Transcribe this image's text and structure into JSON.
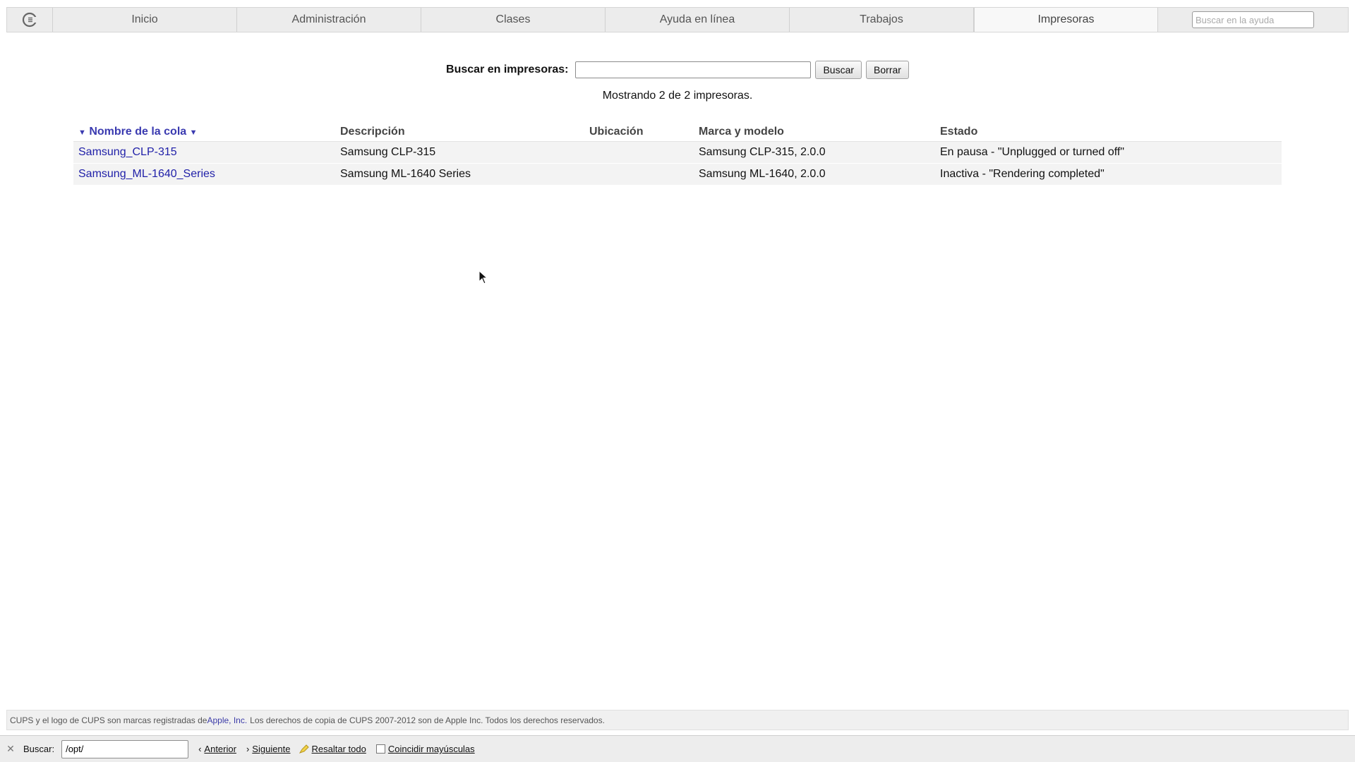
{
  "nav": {
    "logo_icon": "cups-logo-icon",
    "tabs": [
      {
        "label": "Inicio"
      },
      {
        "label": "Administración"
      },
      {
        "label": "Clases"
      },
      {
        "label": "Ayuda en línea"
      },
      {
        "label": "Trabajos"
      },
      {
        "label": "Impresoras"
      }
    ],
    "active_tab": "Impresoras",
    "help_search_placeholder": "Buscar en la ayuda"
  },
  "search": {
    "label": "Buscar en impresoras:",
    "value": "",
    "search_button": "Buscar",
    "clear_button": "Borrar"
  },
  "summary": "Mostrando 2 de 2 impresoras.",
  "table": {
    "sort_arrow_icon": "sort-down-arrow-icon",
    "headers": {
      "queue": "Nombre de la cola",
      "description": "Descripción",
      "location": "Ubicación",
      "model": "Marca y modelo",
      "state": "Estado"
    },
    "rows": [
      {
        "queue": "Samsung_CLP-315",
        "description": "Samsung CLP-315",
        "location": "",
        "model": "Samsung CLP-315, 2.0.0",
        "state": "En pausa - \"Unplugged or turned off\""
      },
      {
        "queue": "Samsung_ML-1640_Series",
        "description": "Samsung ML-1640 Series",
        "location": "",
        "model": "Samsung ML-1640, 2.0.0",
        "state": "Inactiva - \"Rendering completed\""
      }
    ]
  },
  "footer": {
    "text_before": "CUPS y el logo de CUPS son marcas registradas de ",
    "link": "Apple, Inc.",
    "text_after": " Los derechos de copia de CUPS 2007-2012 son de Apple Inc. Todos los derechos reservados."
  },
  "findbar": {
    "label": "Buscar:",
    "value": "/opt/",
    "prev": "Anterior",
    "next": "Siguiente",
    "highlight_all": "Resaltar todo",
    "match_case": "Coincidir mayúsculas",
    "match_case_checked": false
  },
  "colors": {
    "link": "#1f1fa8",
    "sorted_header": "#3a3ab0",
    "tabbar_bg": "#ececec"
  }
}
